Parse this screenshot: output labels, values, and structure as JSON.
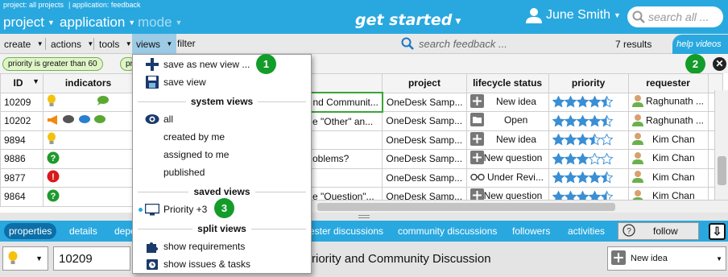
{
  "header": {
    "context": [
      "project: all projects",
      "application: feedback"
    ],
    "project": "project",
    "application": "application",
    "mode": "mode",
    "get_started": "get started",
    "user": "June Smith",
    "search_placeholder": "search all ..."
  },
  "toolbar": {
    "create": "create",
    "actions": "actions",
    "tools": "tools",
    "views": "views",
    "filter": "filter",
    "search_placeholder": "search feedback ...",
    "results": "7 results",
    "help_videos": "help videos"
  },
  "filters": {
    "chip1": "priority is greater than 60",
    "chip2": "pr"
  },
  "badges": {
    "b1": "1",
    "b2": "2",
    "b3": "3"
  },
  "grid": {
    "columns": {
      "id": "ID",
      "indicators": "indicators",
      "project": "project",
      "lifecycle": "lifecycle status",
      "priority": "priority",
      "requester": "requester"
    },
    "rows": [
      {
        "id": "10209",
        "name": "nd Communit...",
        "project": "OneDesk Samp...",
        "status": "New idea",
        "status_icon": "plus-icon",
        "stars": 4.5,
        "requester": "Raghunath ..."
      },
      {
        "id": "10202",
        "name": "e \"Other\" an...",
        "project": "OneDesk Samp...",
        "status": "Open",
        "status_icon": "folder-icon",
        "stars": 4.5,
        "requester": "Raghunath ..."
      },
      {
        "id": "9894",
        "name": "",
        "project": "OneDesk Samp...",
        "status": "New idea",
        "status_icon": "plus-icon",
        "stars": 3.5,
        "requester": "Kim Chan"
      },
      {
        "id": "9886",
        "name": "oblems?",
        "project": "OneDesk Samp...",
        "status": "New question",
        "status_icon": "plus-icon",
        "stars": 3,
        "requester": "Kim Chan"
      },
      {
        "id": "9877",
        "name": "",
        "project": "OneDesk Samp...",
        "status": "Under Revi...",
        "status_icon": "glasses-icon",
        "stars": 4.5,
        "requester": "Kim Chan"
      },
      {
        "id": "9864",
        "name": "e \"Question\"...",
        "project": "OneDesk Samp...",
        "status": "New question",
        "status_icon": "plus-icon",
        "stars": 4.5,
        "requester": "Kim Chan"
      }
    ]
  },
  "views_menu": {
    "save_new": "save as new view ...",
    "save_view": "save view",
    "system_header": "system views",
    "all": "all",
    "created": "created by me",
    "assigned": "assigned to me",
    "published": "published",
    "saved_header": "saved views",
    "priority": "Priority +3",
    "split_header": "split views",
    "show_req": "show requirements",
    "show_issues": "show issues & tasks"
  },
  "panel": {
    "tabs": [
      "properties",
      "details",
      "depe",
      "ester discussions",
      "community discussions",
      "followers",
      "activities"
    ],
    "follow": "follow",
    "id_value": "10209",
    "title": "riority and Community Discussion",
    "status": "New idea"
  },
  "colors": {
    "brand": "#29a8df",
    "badge": "#139c2a",
    "star": "#3a8fd4"
  }
}
